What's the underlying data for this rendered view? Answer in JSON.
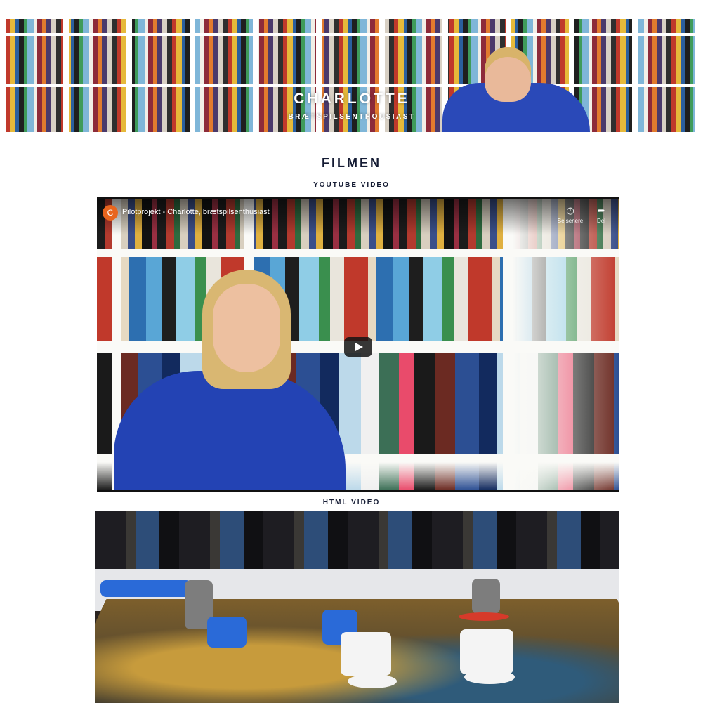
{
  "hero": {
    "title": "CHARLOTTE",
    "subtitle": "BRÆTSPILSENTHOUSIAST"
  },
  "section": {
    "title": "FILMEN"
  },
  "youtube": {
    "label": "YOUTUBE VIDEO",
    "channel_initial": "C",
    "video_title": "Pilotprojekt - Charlotte, brætspilsenthusiast",
    "watch_later_label": "Se senere",
    "share_label": "Del"
  },
  "html_video": {
    "label": "HTML VIDEO"
  },
  "colors": {
    "heading": "#141b33",
    "channel_avatar": "#e8651e"
  },
  "icons": {
    "watch_later": "clock-icon",
    "share": "share-arrow-icon",
    "play": "play-icon"
  }
}
